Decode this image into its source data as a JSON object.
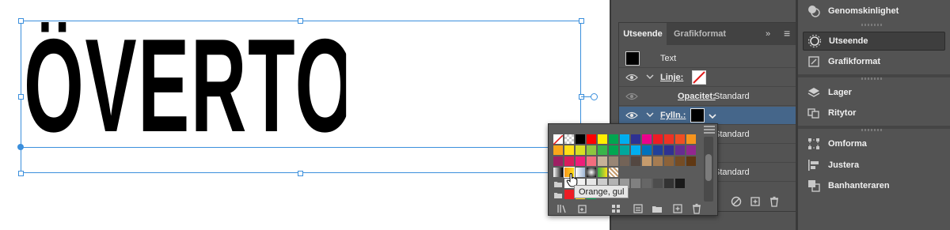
{
  "canvas": {
    "headline": "ÖVERTONING"
  },
  "right_panel": {
    "items": [
      {
        "label": "Genomskinlighet",
        "icon": "transparency-icon",
        "active": false
      },
      {
        "label": "Utseende",
        "icon": "appearance-icon",
        "active": true
      },
      {
        "label": "Grafikformat",
        "icon": "graphic-styles-icon",
        "active": false
      },
      {
        "label": "Lager",
        "icon": "layers-icon",
        "active": false
      },
      {
        "label": "Ritytor",
        "icon": "artboards-icon",
        "active": false
      },
      {
        "label": "Omforma",
        "icon": "transform-icon",
        "active": false
      },
      {
        "label": "Justera",
        "icon": "align-icon",
        "active": false
      },
      {
        "label": "Banhanteraren",
        "icon": "pathfinder-icon",
        "active": false
      }
    ]
  },
  "appearance_panel": {
    "tabs": [
      "Utseende",
      "Grafikformat"
    ],
    "collapse": "»",
    "menu": "≡",
    "rows": {
      "text": "Text",
      "stroke_label": "Linje:",
      "opacity_label": "Opacitet:",
      "opacity_value": "Standard",
      "fill_label": "Fylln.:",
      "row4_value": "Standard",
      "row5_value": "Standard"
    }
  },
  "swatch_popup": {
    "tooltip": "Orange, gul",
    "colors": {
      "row1": [
        "#ffffff",
        "#ffffff",
        "#000000",
        "#ff0000",
        "#ffee00",
        "#00a650",
        "#00aeef",
        "#2e3192",
        "#ec008c",
        "#ed1c24",
        "#ee3224",
        "#f04e23",
        "#f7941d"
      ],
      "row2": [
        "#f9a61a",
        "#ffde17",
        "#d7df23",
        "#8dc63f",
        "#39b54a",
        "#00a651",
        "#00a79d",
        "#00aeef",
        "#0072bc",
        "#21409a",
        "#2e3192",
        "#662d91",
        "#92278f"
      ],
      "row3": [
        "#9e1f63",
        "#d91c5c",
        "#ed1e79",
        "#f26d7d",
        "#c7b299",
        "#998675",
        "#736357",
        "#534741",
        "#c69c6d",
        "#a67c52",
        "#8c6239",
        "#754c24",
        "#603813"
      ],
      "gray": [
        "#ffffff",
        "#f2f2f2",
        "#e6e6e6",
        "#cccccc",
        "#b3b3b3",
        "#999999",
        "#808080",
        "#666666",
        "#4d4d4d",
        "#333333",
        "#1a1a1a"
      ]
    }
  }
}
